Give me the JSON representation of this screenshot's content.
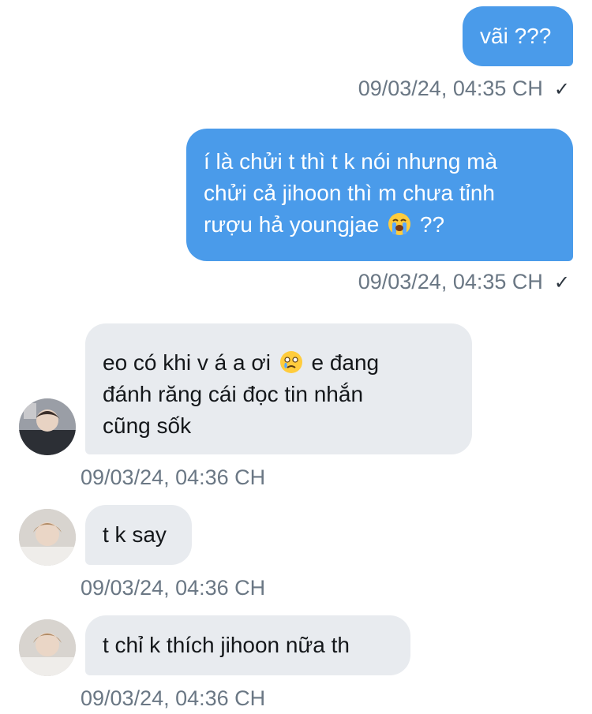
{
  "messages": [
    {
      "direction": "outgoing",
      "text": "vãi ???",
      "timestamp": "09/03/24, 04:35 CH",
      "read": "✓"
    },
    {
      "direction": "outgoing",
      "lines": [
        "í là chửi t thì t k nói nhưng mà",
        "chửi cả jihoon thì m chưa tỉnh",
        "rượu hả youngjae"
      ],
      "tail": " ??",
      "emoji": "loudly-crying-face-emoji",
      "timestamp": "09/03/24, 04:35 CH",
      "read": "✓"
    },
    {
      "direction": "incoming",
      "line1_pre": "eo có khi v á a ơi",
      "line1_emoji": "face-holding-back-tears-emoji",
      "line1_post": " e đang",
      "lines": [
        "đánh răng cái đọc tin nhắn",
        "cũng sốk"
      ],
      "timestamp": "09/03/24, 04:36 CH"
    },
    {
      "direction": "incoming",
      "text": "t k say",
      "timestamp": "09/03/24, 04:36 CH"
    },
    {
      "direction": "incoming",
      "text": "t chỉ k thích jihoon nữa th",
      "timestamp": "09/03/24, 04:36 CH"
    }
  ],
  "colors": {
    "outgoing_bubble": "#4a9bea",
    "incoming_bubble": "#e8ebef",
    "timestamp": "#6a7784"
  }
}
